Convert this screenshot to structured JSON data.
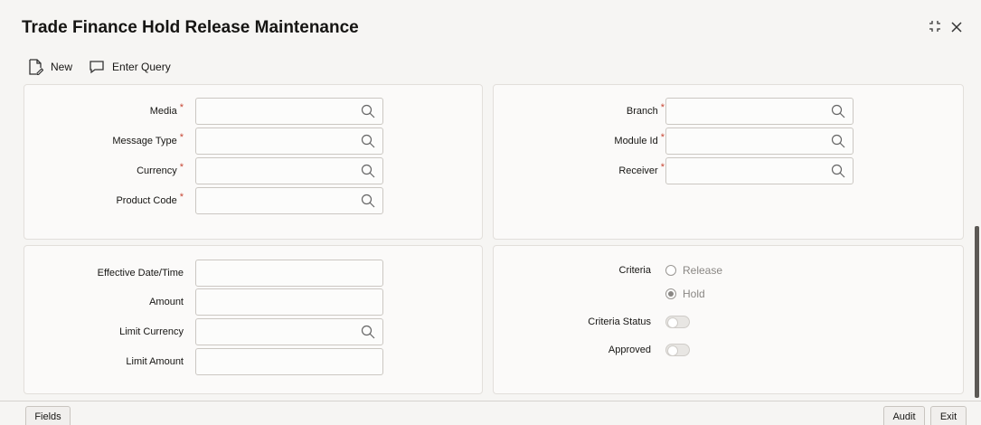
{
  "window": {
    "title": "Trade Finance Hold Release Maintenance",
    "restore_icon": "restore-icon",
    "close_icon": "close-icon"
  },
  "toolbar": {
    "new_label": "New",
    "enter_query_label": "Enter Query"
  },
  "panel_main_left": {
    "media_label": "Media",
    "message_type_label": "Message Type",
    "currency_label": "Currency",
    "product_code_label": "Product Code",
    "required_mark": "*"
  },
  "panel_main_right": {
    "branch_label": "Branch",
    "module_id_label": "Module Id",
    "receiver_label": "Receiver"
  },
  "panel_details_left": {
    "effective_date_label": "Effective Date/Time",
    "amount_label": "Amount",
    "limit_currency_label": "Limit Currency",
    "limit_amount_label": "Limit Amount"
  },
  "panel_details_right": {
    "criteria_label": "Criteria",
    "release_option": "Release",
    "hold_option": "Hold",
    "selected_criteria": "Hold",
    "criteria_status_label": "Criteria Status",
    "approved_label": "Approved"
  },
  "footer": {
    "fields_label": "Fields",
    "audit_label": "Audit",
    "exit_label": "Exit"
  }
}
